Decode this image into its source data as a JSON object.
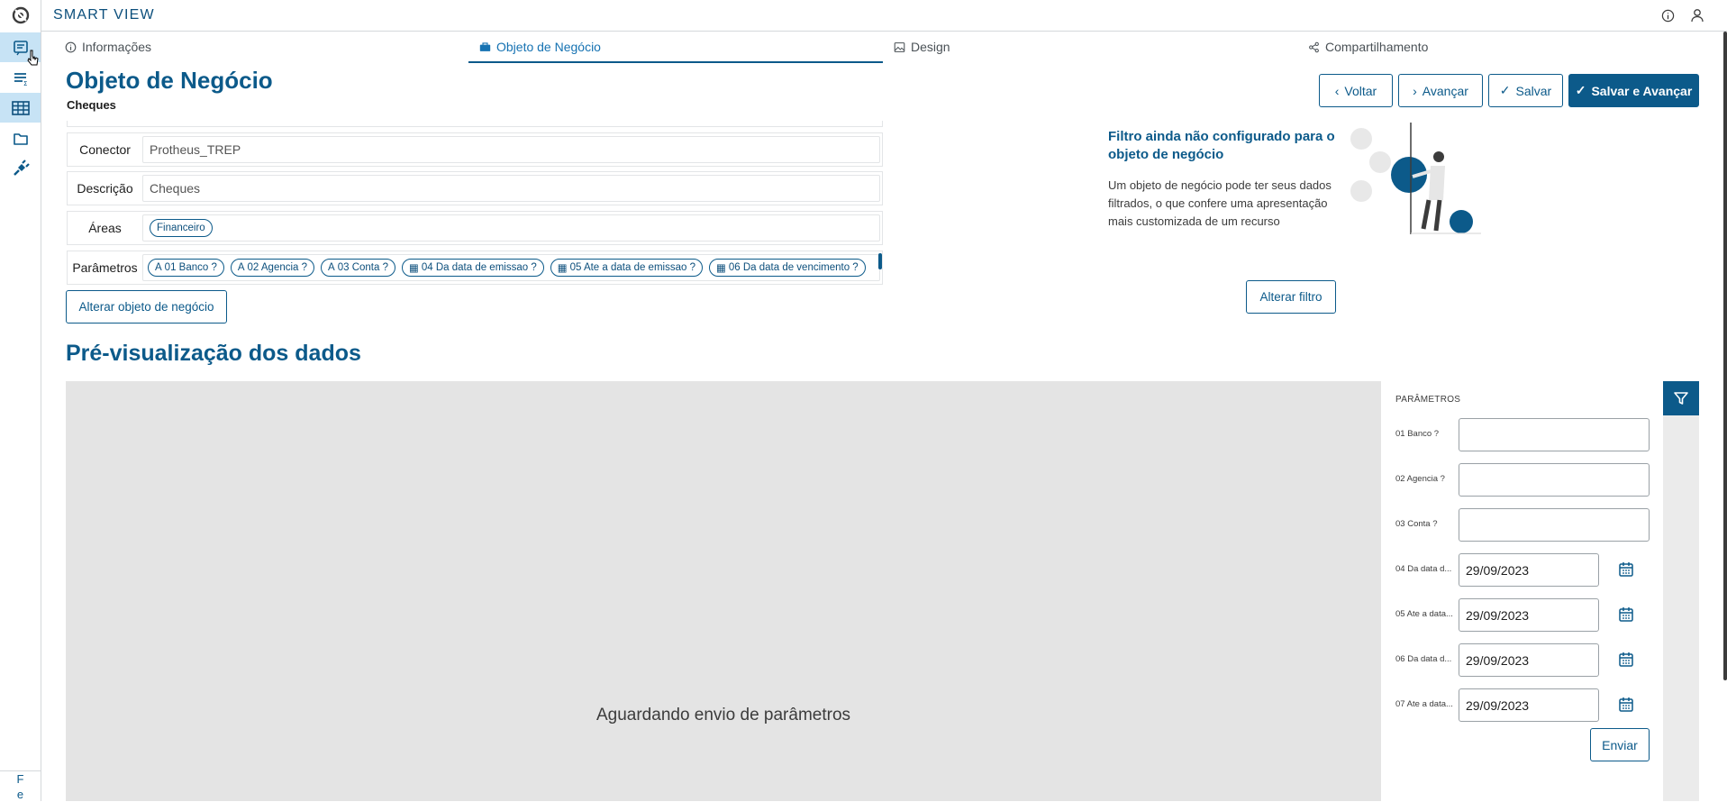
{
  "app": {
    "title": "SMART VIEW"
  },
  "sidebar": {
    "footer": "F\ne"
  },
  "tabs": [
    {
      "label": "Informações",
      "icon": "info-icon"
    },
    {
      "label": "Objeto de Negócio",
      "icon": "briefcase-icon"
    },
    {
      "label": "Design",
      "icon": "image-icon"
    },
    {
      "label": "Compartilhamento",
      "icon": "share-icon"
    }
  ],
  "page": {
    "title": "Objeto de Negócio",
    "subtitle": "Cheques"
  },
  "actions": {
    "back": "Voltar",
    "next": "Avançar",
    "save": "Salvar",
    "save_next": "Salvar e Avançar"
  },
  "form": {
    "connector_label": "Conector",
    "connector_value": "Protheus_TREP",
    "description_label": "Descrição",
    "description_value": "Cheques",
    "areas_label": "Áreas",
    "areas": [
      "Financeiro"
    ],
    "params_label": "Parâmetros",
    "params": [
      "01 Banco ?",
      "02 Agencia ?",
      "03 Conta ?",
      "04 Da data de emissao ?",
      "05 Ate a data de emissao ?",
      "06 Da data de vencimento ?"
    ],
    "change_button": "Alterar objeto de negócio"
  },
  "filter": {
    "title": "Filtro ainda não configurado para o objeto de negócio",
    "description": "Um objeto de negócio pode ter seus dados filtrados, o que confere uma apresentação mais customizada de um recurso",
    "button": "Alterar filtro"
  },
  "preview": {
    "title": "Pré-visualização dos dados",
    "message": "Aguardando envio de parâmetros"
  },
  "parameters_panel": {
    "heading": "PARÂMETROS",
    "fields": [
      {
        "label": "01 Banco ?",
        "value": ""
      },
      {
        "label": "02 Agencia ?",
        "value": ""
      },
      {
        "label": "03 Conta ?",
        "value": ""
      },
      {
        "label": "04 Da data d...",
        "value": "29/09/2023"
      },
      {
        "label": "05 Ate a data...",
        "value": "29/09/2023"
      },
      {
        "label": "06 Da data d...",
        "value": "29/09/2023"
      },
      {
        "label": "07 Ate a data...",
        "value": "29/09/2023"
      }
    ],
    "send_button": "Enviar"
  },
  "colors": {
    "primary": "#0c5a8a",
    "sidebar_active": "#c7e3f5",
    "preview_bg": "#e4e4e4"
  }
}
